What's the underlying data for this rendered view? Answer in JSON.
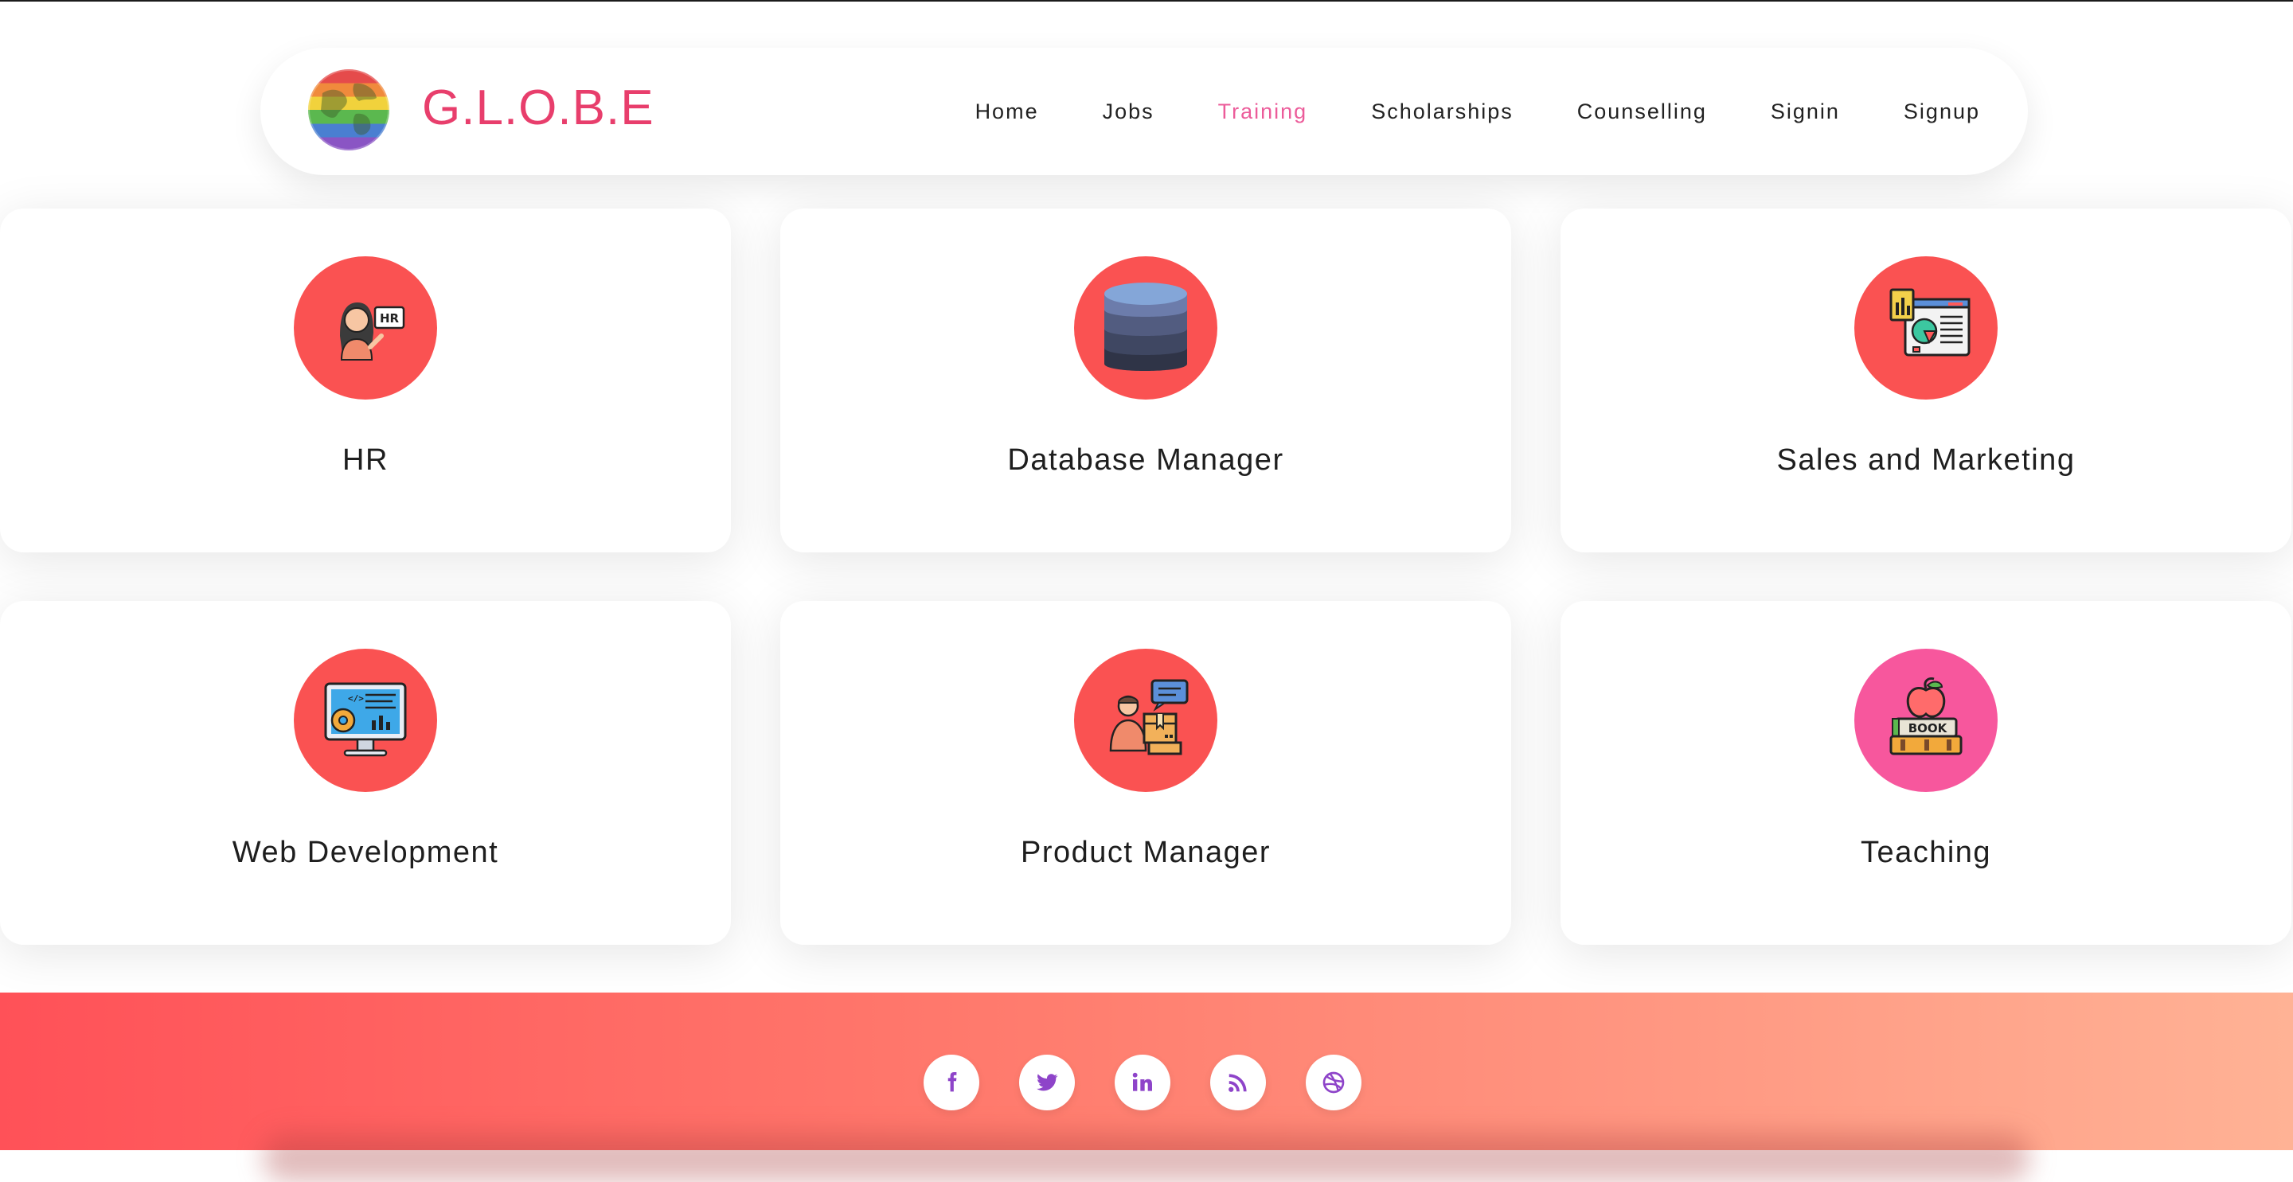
{
  "brand": {
    "name": "G.L.O.B.E",
    "logo_icon": "rainbow-globe-icon",
    "color": "#e83e6c"
  },
  "nav": {
    "items": [
      {
        "label": "Home",
        "active": false
      },
      {
        "label": "Jobs",
        "active": false
      },
      {
        "label": "Training",
        "active": true
      },
      {
        "label": "Scholarships",
        "active": false
      },
      {
        "label": "Counselling",
        "active": false
      },
      {
        "label": "Signin",
        "active": false
      },
      {
        "label": "Signup",
        "active": false
      }
    ],
    "active_color": "#ec5c9a"
  },
  "cards": [
    {
      "title": "HR",
      "icon": "hr-presenter-icon"
    },
    {
      "title": "Database Manager",
      "icon": "database-icon"
    },
    {
      "title": "Sales and Marketing",
      "icon": "sales-report-icon"
    },
    {
      "title": "Web Development",
      "icon": "web-development-monitor-icon"
    },
    {
      "title": "Product Manager",
      "icon": "product-manager-icon"
    },
    {
      "title": "Teaching",
      "icon": "book-apple-icon"
    }
  ],
  "footer": {
    "social": [
      {
        "icon": "facebook-icon"
      },
      {
        "icon": "twitter-icon"
      },
      {
        "icon": "linkedin-icon"
      },
      {
        "icon": "rss-icon"
      },
      {
        "icon": "dribbble-icon"
      }
    ],
    "icon_color": "#8e44c9"
  },
  "colors": {
    "accent_red": "#fa5252",
    "accent_pink": "#f7579d"
  }
}
